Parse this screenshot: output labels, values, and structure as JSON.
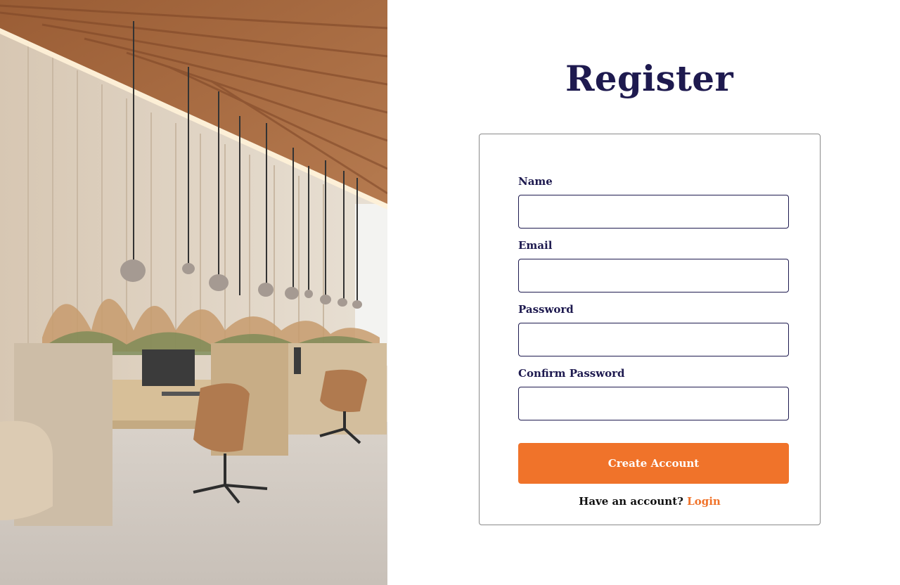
{
  "page": {
    "title": "Register"
  },
  "form": {
    "fields": [
      {
        "label": "Name",
        "value": "",
        "placeholder": ""
      },
      {
        "label": "Email",
        "value": "",
        "placeholder": ""
      },
      {
        "label": "Password",
        "value": "",
        "placeholder": ""
      },
      {
        "label": "Confirm Password",
        "value": "",
        "placeholder": ""
      }
    ],
    "submit_label": "Create Account",
    "footer_text": "Have an account?",
    "login_label": "Login"
  },
  "colors": {
    "brand_dark": "#1e1a4f",
    "accent": "#f0732a"
  }
}
